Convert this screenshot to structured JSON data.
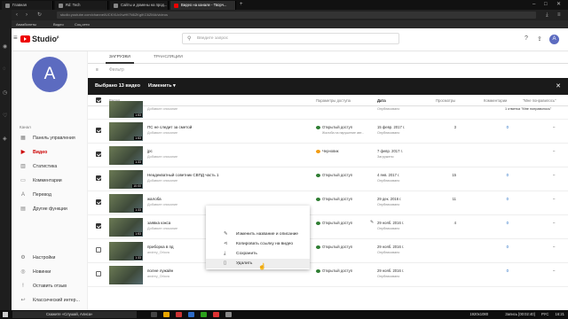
{
  "browser": {
    "tabs": [
      "Главная",
      "Rd: Tech",
      "Сайты и домены на прод...",
      "Видео на канале - Творч..."
    ],
    "url": "studio.youtube.com/channel/UCKXUvXwHt7N6ZKgiKC6ZMA/videos",
    "bookmarks": [
      "Авиабилеты",
      "Видео",
      "Соц.сети"
    ]
  },
  "header": {
    "logo": "Studio",
    "logo_beta": "β",
    "search_placeholder": "Введите запрос",
    "avatar_letter": "A"
  },
  "sidebar": {
    "avatar_letter": "A",
    "channel_label": "Канал",
    "items": [
      {
        "label": "Панель управления",
        "icon": "dashboard-icon"
      },
      {
        "label": "Видео",
        "icon": "video-icon"
      },
      {
        "label": "Статистика",
        "icon": "stats-icon"
      },
      {
        "label": "Комментарии",
        "icon": "comments-icon"
      },
      {
        "label": "Перевод",
        "icon": "translate-icon"
      },
      {
        "label": "Другие функции",
        "icon": "other-functions-icon"
      }
    ],
    "bottom_items": [
      {
        "label": "Настройки",
        "icon": "settings-icon"
      },
      {
        "label": "Новинки",
        "icon": "news-icon"
      },
      {
        "label": "Оставить отзыв",
        "icon": "feedback-icon"
      },
      {
        "label": "Классический интер...",
        "icon": "classic-icon"
      }
    ]
  },
  "main": {
    "tabs": [
      "ЗАГРУЗКИ",
      "ТРАНСЛЯЦИИ"
    ],
    "filter_placeholder": "Фильтр",
    "selection": {
      "count_label": "Выбрано 13 видео",
      "edit_label": "Изменить",
      "close": "✕"
    },
    "columns": [
      "Видео",
      "Параметры доступа",
      "Дата",
      "Просмотры",
      "Комментарии",
      "\"Мне понравилось\""
    ],
    "partial_row": {
      "desc": "Добавьте описание",
      "date_status": "Опубликовано",
      "likes": "1 отметка \"Мне понравилось\""
    },
    "rows": [
      {
        "title": "ПС не следит за сметой",
        "desc": "Добавьте описание",
        "duration": "1:53",
        "checked": true,
        "visibility": "Открытый доступ",
        "vis_note": "Жалоба на нарушение авт...",
        "draft": false,
        "date": "15 февр. 2017 г.",
        "date_status": "Опубликовано",
        "views": "3",
        "comments": "0",
        "likes": "–"
      },
      {
        "title": "jpc",
        "desc": "Добавьте описание",
        "duration": "1:33",
        "checked": true,
        "visibility": "Черновик",
        "vis_note": "",
        "draft": true,
        "date": "7 февр. 2017 г.",
        "date_status": "Загружено",
        "views": "",
        "comments": "",
        "likes": "–"
      },
      {
        "title": "Неадекватный советник СВПД часть 1",
        "desc": "Добавьте описание",
        "duration": "10:00",
        "checked": true,
        "visibility": "Открытый доступ",
        "vis_note": "",
        "draft": false,
        "date": "4 янв. 2017 г.",
        "date_status": "Опубликовано",
        "views": "15",
        "comments": "0",
        "likes": "–"
      },
      {
        "title": "жалоба",
        "desc": "Добавьте описание",
        "duration": "1:33",
        "checked": true,
        "visibility": "Открытый доступ",
        "vis_note": "",
        "draft": false,
        "date": "29 дек. 2016 г.",
        "date_status": "Опубликовано",
        "views": "11",
        "comments": "0",
        "likes": "–"
      },
      {
        "title": "заявка кэкса",
        "desc": "Добавьте описание",
        "duration": "1:53",
        "checked": true,
        "visibility": "Открытый доступ",
        "vis_note": "",
        "draft": false,
        "date": "29 нояб. 2016 г.",
        "date_status": "Опубликовано",
        "views": "4",
        "comments": "0",
        "likes": "–"
      },
      {
        "title": "приборка в пд",
        "desc": "andrey_Orlova",
        "duration": "1:33",
        "checked": false,
        "visibility": "Открытый доступ",
        "vis_note": "",
        "draft": false,
        "date": "29 нояб. 2016 г.",
        "date_status": "Опубликовано",
        "views": "",
        "comments": "0",
        "likes": "–"
      },
      {
        "title": "полне лужайн",
        "desc": "andrey_Orlova",
        "duration": "",
        "checked": false,
        "visibility": "Открытый доступ",
        "vis_note": "",
        "draft": false,
        "date": "29 нояб. 2016 г.",
        "date_status": "Опубликовано",
        "views": "",
        "comments": "0",
        "likes": "–"
      }
    ]
  },
  "context_menu": [
    {
      "label": "Изменить название и описание",
      "icon": "pencil-icon"
    },
    {
      "label": "Копировать ссылку на видео",
      "icon": "share-icon"
    },
    {
      "label": "Сохранить",
      "icon": "download-icon"
    },
    {
      "label": "Удалить",
      "icon": "trash-icon"
    }
  ],
  "taskbar": {
    "search_text": "Скажите «Слушай, Алиса»",
    "tray_text": "Запись [00:02:40]",
    "time": "16:21",
    "date": "29.11.2018",
    "lang": "РУС",
    "fps": "1920x1080"
  }
}
